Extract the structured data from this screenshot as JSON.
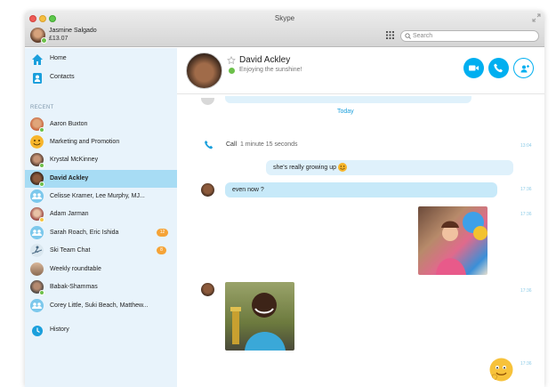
{
  "window": {
    "title": "Skype"
  },
  "user": {
    "name": "Jasmine Salgado",
    "credit": "£13.07"
  },
  "search": {
    "placeholder": "Search"
  },
  "nav": [
    {
      "label": "Home",
      "icon": "home-icon"
    },
    {
      "label": "Contacts",
      "icon": "contacts-icon"
    }
  ],
  "recent_header": "RECENT",
  "contacts": [
    {
      "name": "Aaron Buxton",
      "presence": "online"
    },
    {
      "name": "Marketing and Promotion",
      "icon": "smiley-icon"
    },
    {
      "name": "Krystal McKinney",
      "presence": "online"
    },
    {
      "name": "David Ackley",
      "presence": "online",
      "active": true
    },
    {
      "name": "Celisse Kramer, Lee Murphy, MJ...",
      "icon": "group-icon"
    },
    {
      "name": "Adam Jarman",
      "presence": "away"
    },
    {
      "name": "Sarah Roach, Eric Ishida",
      "icon": "group-icon",
      "badge": "12"
    },
    {
      "name": "Ski Team Chat",
      "icon": "group-icon",
      "badge": "8"
    },
    {
      "name": "Weekly roundtable"
    },
    {
      "name": "Babak-Shammas",
      "presence": "online"
    },
    {
      "name": "Corey Little, Suki Beach, Matthew...",
      "icon": "group-icon"
    }
  ],
  "history": {
    "label": "History",
    "icon": "history-icon"
  },
  "conversation": {
    "name": "David Ackley",
    "mood": "Enjoying the sunshine!",
    "day_label": "Today",
    "call": {
      "label": "Call",
      "duration": "1 minute 15 seconds",
      "time": "13:04"
    },
    "messages": [
      {
        "text": "she's really growing up",
        "time": ""
      },
      {
        "text": "even now ?",
        "time": "17:36"
      },
      {
        "time": "17:36"
      },
      {
        "time": "17:36"
      },
      {
        "time": "17:36"
      }
    ]
  },
  "colors": {
    "accent": "#00aff0",
    "sidebar": "#e8f3fb",
    "selected": "#a7dcf4",
    "badge": "#f5a336"
  }
}
